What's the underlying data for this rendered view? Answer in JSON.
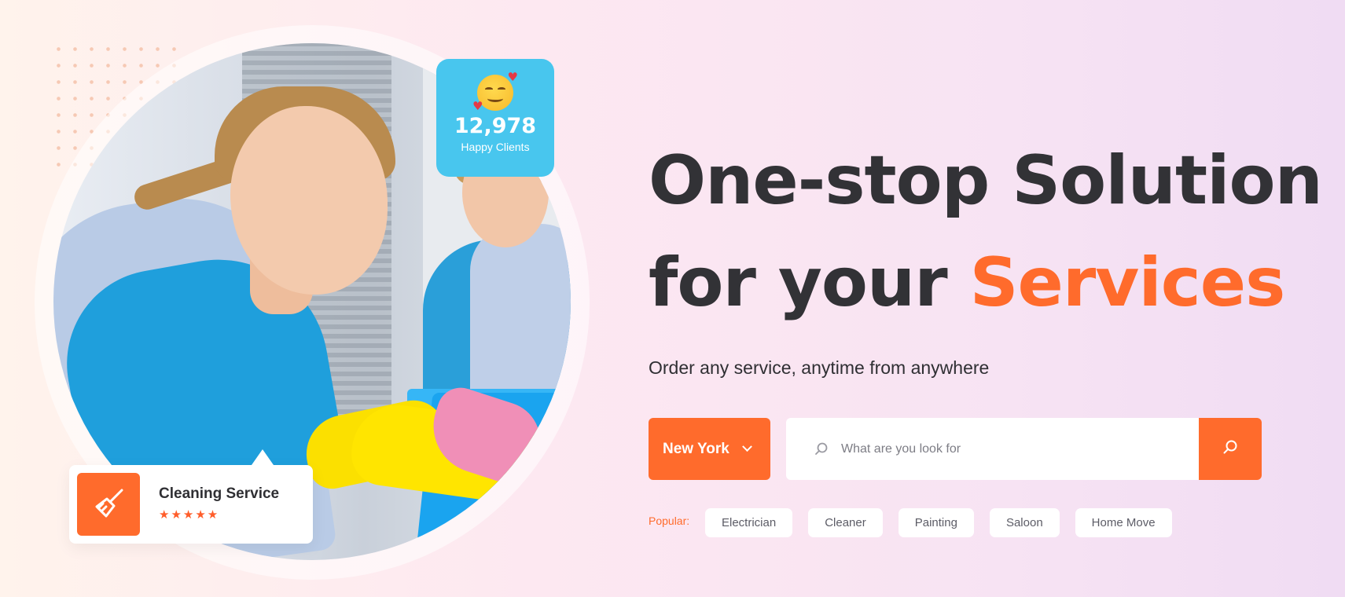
{
  "hero": {
    "title_line1": "One-stop Solution",
    "title_line2_prefix": "for your ",
    "title_line2_accent": "Services",
    "subtitle": "Order any service, anytime from anywhere"
  },
  "stats_card": {
    "icon": "smiling-face-with-hearts-icon",
    "value": "12,978",
    "label": "Happy Clients"
  },
  "service_card": {
    "icon": "broom-icon",
    "title": "Cleaning Service",
    "stars": "★★★★★",
    "rating": 5
  },
  "search": {
    "city": "New York",
    "placeholder": "What are you look for",
    "value": ""
  },
  "popular": {
    "label": "Popular:",
    "tags": [
      "Electrician",
      "Cleaner",
      "Painting",
      "Saloon",
      "Home Move"
    ]
  },
  "colors": {
    "accent": "#ff6b2c",
    "card_blue": "#48c6ee",
    "heading": "#323236"
  }
}
